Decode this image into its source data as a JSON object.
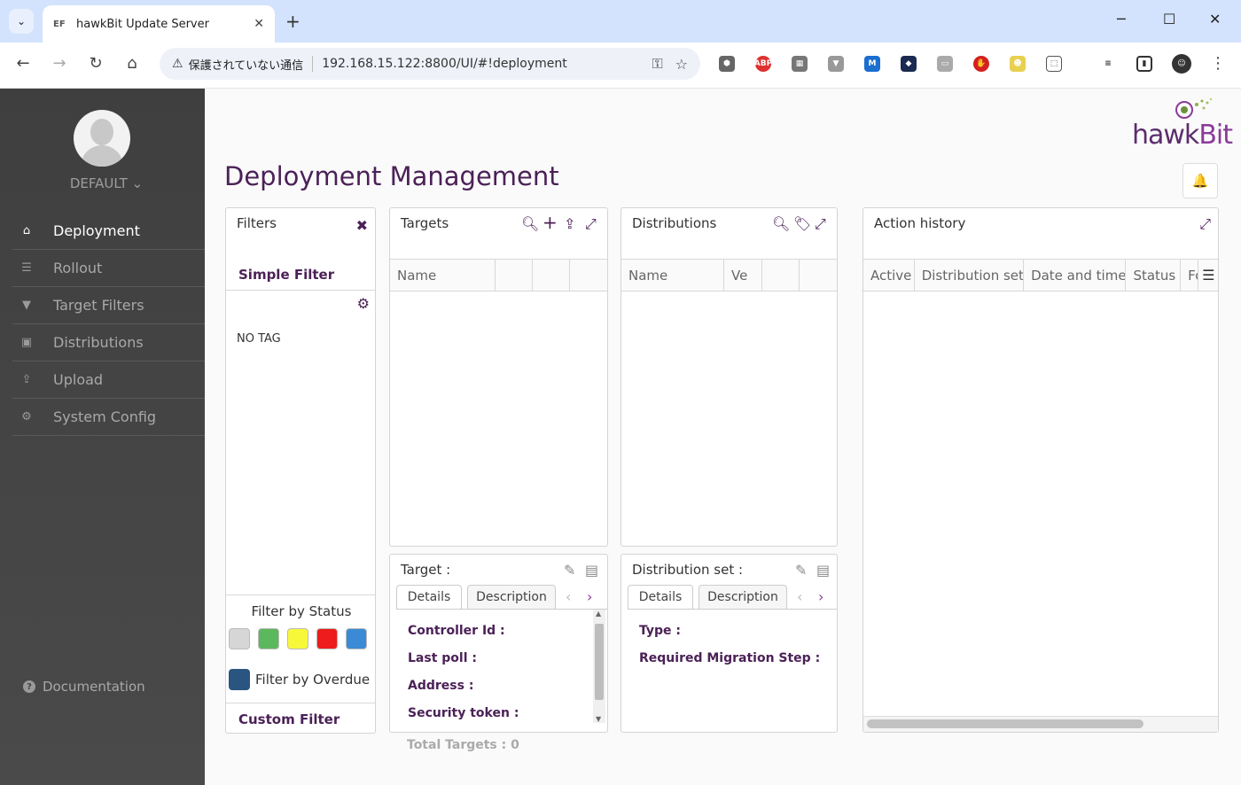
{
  "browser": {
    "tab_title": "hawkBit Update Server",
    "tab_favicon": "EF",
    "security_text": "保護されていない通信",
    "url": "192.168.15.122:8800/UI/#!deployment"
  },
  "sidebar": {
    "tenant": "DEFAULT ⌄",
    "menu": [
      {
        "label": "Deployment",
        "icon": "home-icon"
      },
      {
        "label": "Rollout",
        "icon": "list-icon"
      },
      {
        "label": "Target Filters",
        "icon": "filter-icon"
      },
      {
        "label": "Distributions",
        "icon": "briefcase-icon"
      },
      {
        "label": "Upload",
        "icon": "upload-icon"
      },
      {
        "label": "System Config",
        "icon": "gear-icon"
      }
    ],
    "documentation": "Documentation"
  },
  "header": {
    "page_title": "Deployment Management",
    "logo_hawk": "hawk",
    "logo_bit": "Bit"
  },
  "filters": {
    "caption": "Filters",
    "simple_filter": "Simple Filter",
    "no_tag": "NO TAG",
    "filter_by_status": "Filter by Status",
    "status_colors": [
      "#d6d6d6",
      "#5cb85c",
      "#f8f83a",
      "#ee1c1c",
      "#3a8ad6"
    ],
    "filter_by_overdue": "Filter by Overdue",
    "overdue_color": "#2a5580",
    "custom_filter": "Custom Filter"
  },
  "targets": {
    "caption": "Targets",
    "columns": [
      "Name",
      "",
      "",
      ""
    ],
    "details_caption": "Target :",
    "tabs": [
      "Details",
      "Description"
    ],
    "fields": [
      "Controller Id :",
      "Last poll :",
      "Address :",
      "Security token :"
    ],
    "total": "Total Targets : 0"
  },
  "distributions": {
    "caption": "Distributions",
    "columns": [
      "Name",
      "Ve",
      "",
      ""
    ],
    "details_caption": "Distribution set :",
    "tabs": [
      "Details",
      "Description"
    ],
    "fields": [
      "Type :",
      "Required Migration Step :"
    ]
  },
  "action_history": {
    "caption": "Action history",
    "columns": [
      "Active",
      "Distribution set",
      "Date and time",
      "Status",
      "Fo"
    ]
  }
}
